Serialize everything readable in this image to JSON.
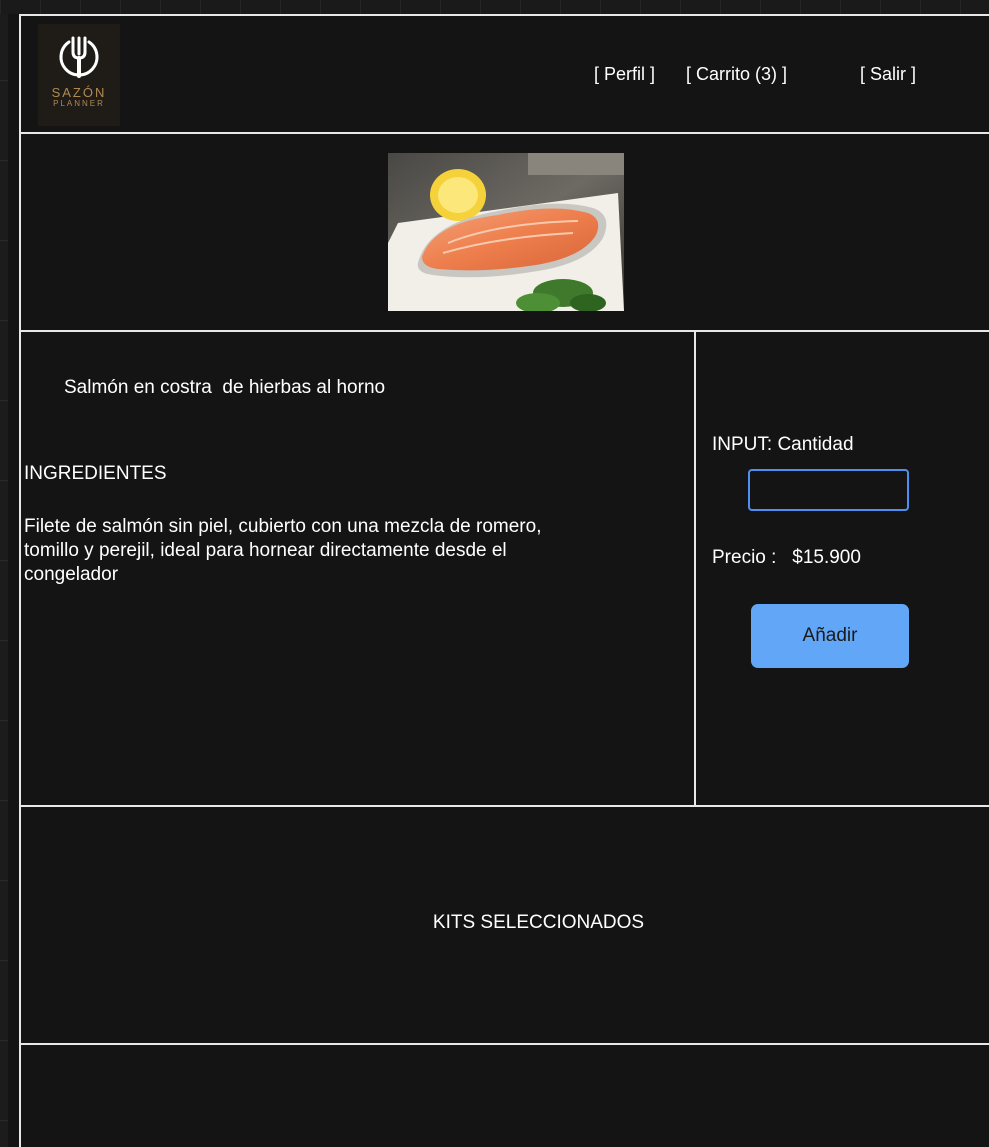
{
  "header": {
    "logo": {
      "name": "SAZÓN",
      "subtitle": "PLANNER",
      "icon": "fork-plate-icon",
      "color": "#b08a52"
    },
    "nav": {
      "profile_label": "[ Perfil ]",
      "cart_label": "[ Carrito (3) ]",
      "logout_label": "[ Salir ]"
    }
  },
  "product": {
    "image": "salmon-steak-photo",
    "title": "Salmón en costra  de hierbas al horno",
    "ingredients_heading": "INGREDIENTES",
    "description": " Filete de salmón sin piel, cubierto con una   mezcla de romero,\ntomillo y perejil, ideal   para hornear directamente desde el\n congelador"
  },
  "purchase": {
    "quantity_label": "INPUT: Cantidad",
    "quantity_value": "",
    "price_label": "Precio :   $15.900",
    "add_label": "Añadir",
    "accent": "#62a7f7",
    "input_border": "#4f8ff0"
  },
  "kits": {
    "heading": "KITS SELECCIONADOS"
  }
}
